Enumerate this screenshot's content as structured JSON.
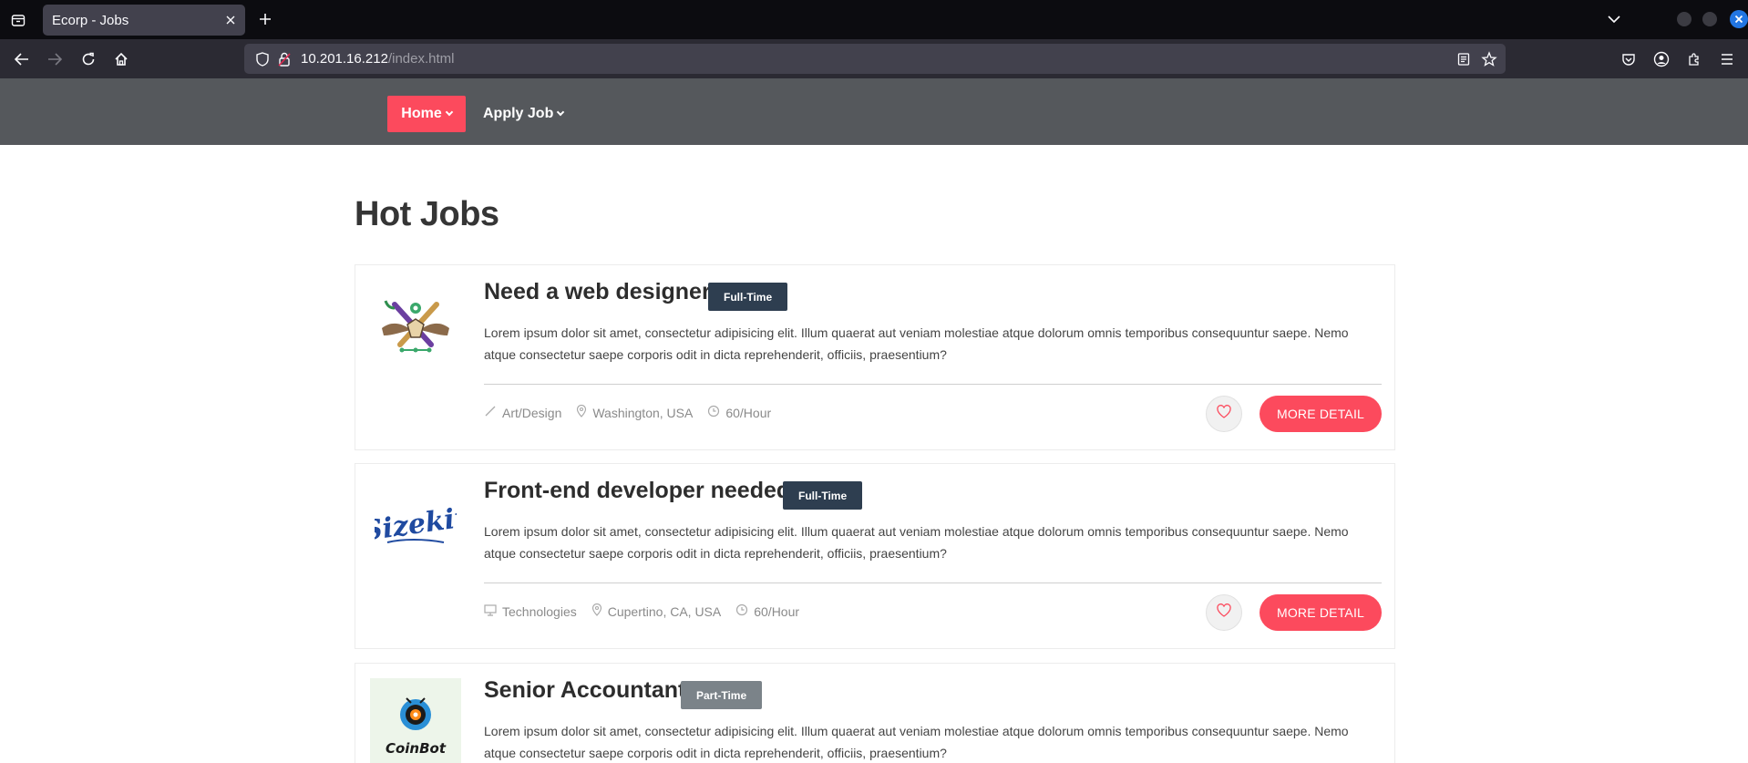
{
  "browser": {
    "tab_title": "Ecorp - Jobs",
    "url_host": "10.201.16.212",
    "url_path": "/index.html"
  },
  "site_nav": {
    "home_label": "Home",
    "apply_label": "Apply Job"
  },
  "section_title": "Hot Jobs",
  "jobs": [
    {
      "title": "Need a web designer",
      "badge": "Full-Time",
      "description": "Lorem ipsum dolor sit amet, consectetur adipisicing elit. Illum quaerat aut veniam molestiae atque dolorum omnis temporibus consequuntur saepe. Nemo atque consectetur saepe corporis odit in dicta reprehenderit, officiis, praesentium?",
      "category": "Art/Design",
      "location": "Washington, USA",
      "rate": "60/Hour",
      "detail_label": "MORE DETAIL"
    },
    {
      "title": "Front-end developer needed",
      "badge": "Full-Time",
      "description": "Lorem ipsum dolor sit amet, consectetur adipisicing elit. Illum quaerat aut veniam molestiae atque dolorum omnis temporibus consequuntur saepe. Nemo atque consectetur saepe corporis odit in dicta reprehenderit, officiis, praesentium?",
      "category": "Technologies",
      "location": "Cupertino, CA, USA",
      "rate": "60/Hour",
      "detail_label": "MORE DETAIL"
    },
    {
      "title": "Senior Accountant",
      "badge": "Part-Time",
      "description": "Lorem ipsum dolor sit amet, consectetur adipisicing elit. Illum quaerat aut veniam molestiae atque dolorum omnis temporibus consequuntur saepe. Nemo atque consectetur saepe corporis odit in dicta reprehenderit, officiis, praesentium?",
      "logo_text": "CoinBot"
    }
  ],
  "colors": {
    "accent": "#fc4a5d",
    "header_bg": "#55585c",
    "badge_full": "#2e3e50",
    "badge_part": "#7b8389"
  },
  "icons": {
    "category_1": "brush-icon",
    "category_2": "monitor-icon",
    "location": "map-pin-icon",
    "rate": "clock-icon",
    "favorite": "heart-icon"
  }
}
